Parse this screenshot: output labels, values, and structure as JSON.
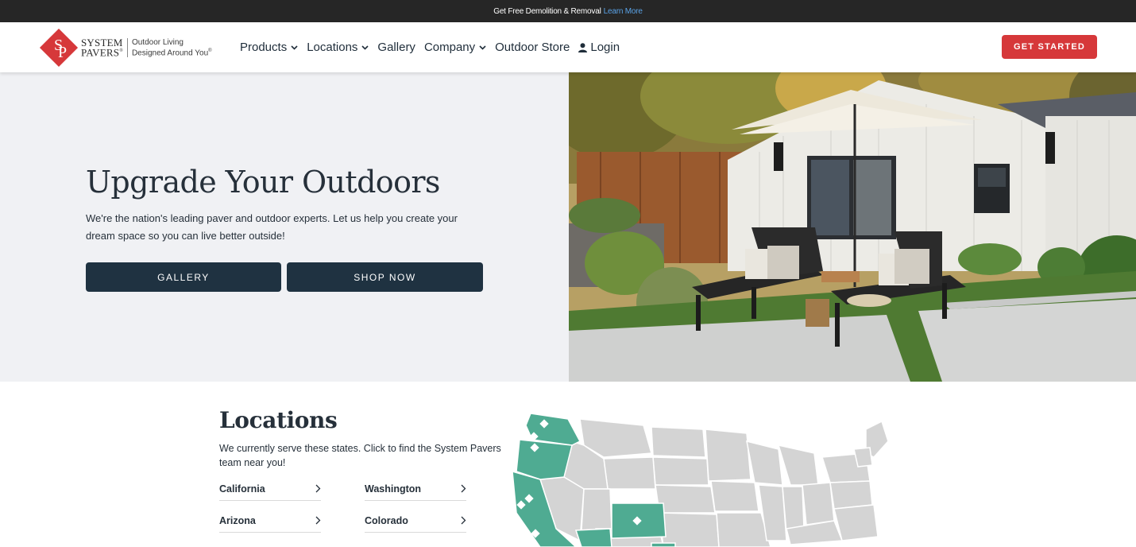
{
  "topbar": {
    "text": "Get Free Demolition & Removal",
    "link": "Learn More"
  },
  "logo": {
    "word_line1": "SYSTEM",
    "word_line2": "PAVERS",
    "registered": "®",
    "tag_line1": "Outdoor Living",
    "tag_line2": "Designed Around You",
    "tm": "®"
  },
  "nav": [
    {
      "label": "Products",
      "icon": "chevron-down-icon"
    },
    {
      "label": "Locations",
      "icon": "chevron-down-icon"
    },
    {
      "label": "Gallery"
    },
    {
      "label": "Company",
      "icon": "chevron-down-icon"
    },
    {
      "label": "Outdoor Store"
    },
    {
      "label": "Login",
      "icon": "user-icon"
    }
  ],
  "cta": "GET STARTED",
  "hero": {
    "title": "Upgrade Your Outdoors",
    "subtitle": "We're the nation's leading paver and outdoor experts. Let us help you create your dream space so you can live better outside!",
    "buttons": [
      "GALLERY",
      "SHOP NOW"
    ]
  },
  "locations": {
    "title": "Locations",
    "subtitle": "We currently serve these states. Click to find the System Pavers team near you!",
    "states": [
      "California",
      "Washington",
      "Arizona",
      "Colorado"
    ],
    "arrow_icon": "chevron-right-icon"
  },
  "colors": {
    "accent_red": "#d6383a",
    "dark_button": "#1f3241",
    "map_served": "#4fab92",
    "map_other": "#d4d4d4"
  }
}
